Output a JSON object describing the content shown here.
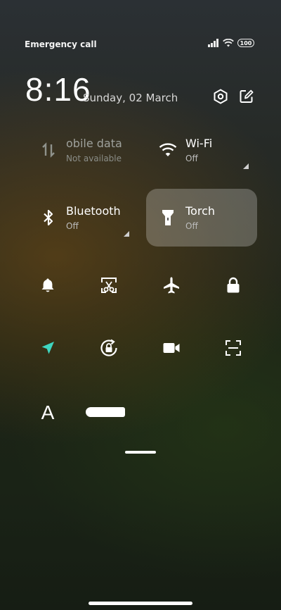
{
  "status_bar": {
    "carrier_text": "Emergency calls o",
    "battery_level": "100"
  },
  "header": {
    "time": "8:16",
    "date": "Sunday, 02 March"
  },
  "tiles": {
    "mobile_data": {
      "title": "obile data",
      "subtitle": "Not available",
      "enabled": false
    },
    "wifi": {
      "title": "Wi-Fi",
      "subtitle": "Off"
    },
    "bluetooth": {
      "title": "Bluetooth",
      "subtitle": "Off"
    },
    "torch": {
      "title": "Torch",
      "subtitle": "Off",
      "highlighted": true
    }
  },
  "quick_toggles": [
    {
      "icon": "bell-icon"
    },
    {
      "icon": "screenshot-icon"
    },
    {
      "icon": "airplane-icon"
    },
    {
      "icon": "lock-icon"
    },
    {
      "icon": "location-icon",
      "active": true,
      "color": "#3fd6c0"
    },
    {
      "icon": "rotation-lock-icon"
    },
    {
      "icon": "video-camera-icon"
    },
    {
      "icon": "scan-icon"
    }
  ],
  "bottom_row": {
    "font_label": "A"
  },
  "colors": {
    "accent": "#3fd6c0",
    "active_tile_bg": "rgba(255,255,255,0.24)"
  }
}
